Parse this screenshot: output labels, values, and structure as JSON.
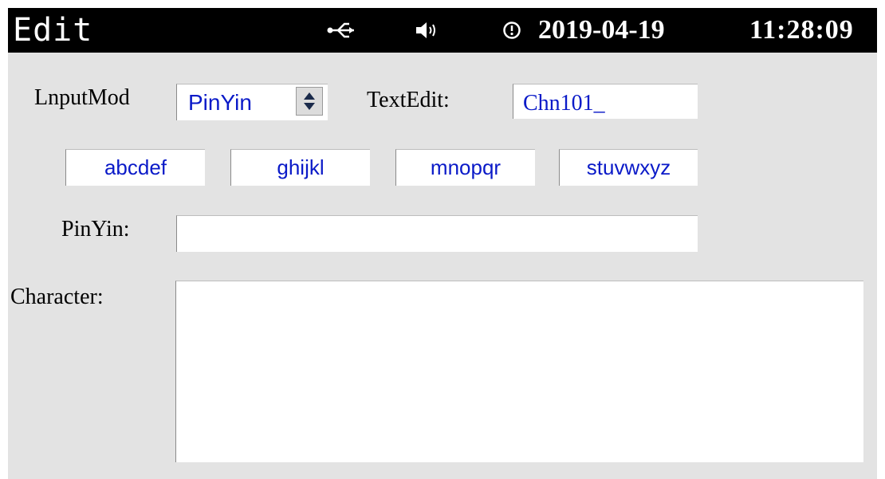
{
  "header": {
    "title": "Edit",
    "date": "2019-04-19",
    "time": "11:28:09",
    "icons": [
      "usb-icon",
      "speaker-icon",
      "clock-icon"
    ]
  },
  "input_mode": {
    "label": "LnputMod",
    "value": "PinYin"
  },
  "text_edit": {
    "label": "TextEdit:",
    "value": "Chn101_"
  },
  "keys": [
    "abcdef",
    "ghijkl",
    "mnopqr",
    "stuvwxyz"
  ],
  "pinyin": {
    "label": "PinYin:",
    "value": ""
  },
  "character": {
    "label": "Character:",
    "value": ""
  },
  "colors": {
    "accent_text": "#0a1ac8",
    "background": "#e3e3e3",
    "topbar": "#000000"
  }
}
